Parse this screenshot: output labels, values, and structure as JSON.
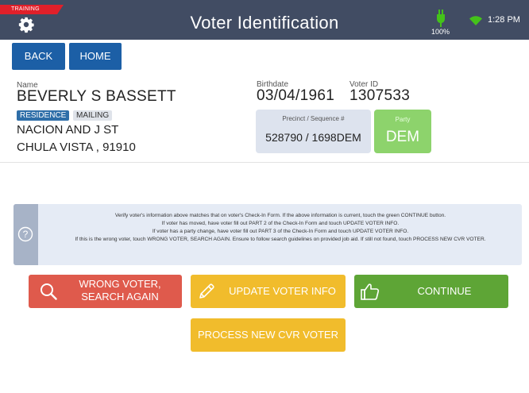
{
  "header": {
    "training_badge": "TRAINING",
    "title": "Voter Identification",
    "battery_percent": "100%",
    "time": "1:28 PM",
    "icons": [
      "gear-icon",
      "battery-charging-icon",
      "wifi-icon"
    ]
  },
  "nav": {
    "back_label": "BACK",
    "home_label": "HOME"
  },
  "voter": {
    "name_label": "Name",
    "name": "BEVERLY S BASSETT",
    "birthdate_label": "Birthdate",
    "birthdate": "03/04/1961",
    "voter_id_label": "Voter ID",
    "voter_id": "1307533",
    "address_tabs": [
      "RESIDENCE",
      "MAILING"
    ],
    "address_line1": "NACION AND J ST",
    "address_line2": "CHULA VISTA , 91910",
    "precinct_label": "Precinct / Sequence #",
    "precinct_value": "528790 / 1698DEM",
    "party_label": "Party",
    "party_value": "DEM"
  },
  "instructions": {
    "line1": "Verify voter's information above matches that on voter's Check-In Form. If the above information is current, touch the green CONTINUE button.",
    "line2": "If voter has moved, have voter fill out PART 2 of the Check-In Form and touch UPDATE VOTER INFO.",
    "line3": "If voter has a party change, have voter fill out PART 3 of the Check-In Form and touch UPDATE VOTER INFO.",
    "line4": "If this is the wrong voter, touch WRONG VOTER, SEARCH AGAIN. Ensure to follow search guidelines on provided job aid. If still not found, touch PROCESS NEW CVR VOTER."
  },
  "actions": {
    "wrong_voter_line1": "WRONG VOTER,",
    "wrong_voter_line2": "SEARCH AGAIN",
    "update_label": "UPDATE VOTER INFO",
    "continue_label": "CONTINUE",
    "process_label": "PROCESS NEW CVR VOTER"
  },
  "colors": {
    "header": "#414c63",
    "nav_button": "#1c5fa6",
    "wrong_voter": "#df5a4c",
    "update": "#f1bc2c",
    "continue": "#5ea536",
    "party": "#8dd36c",
    "accent_green": "#44c21a"
  }
}
